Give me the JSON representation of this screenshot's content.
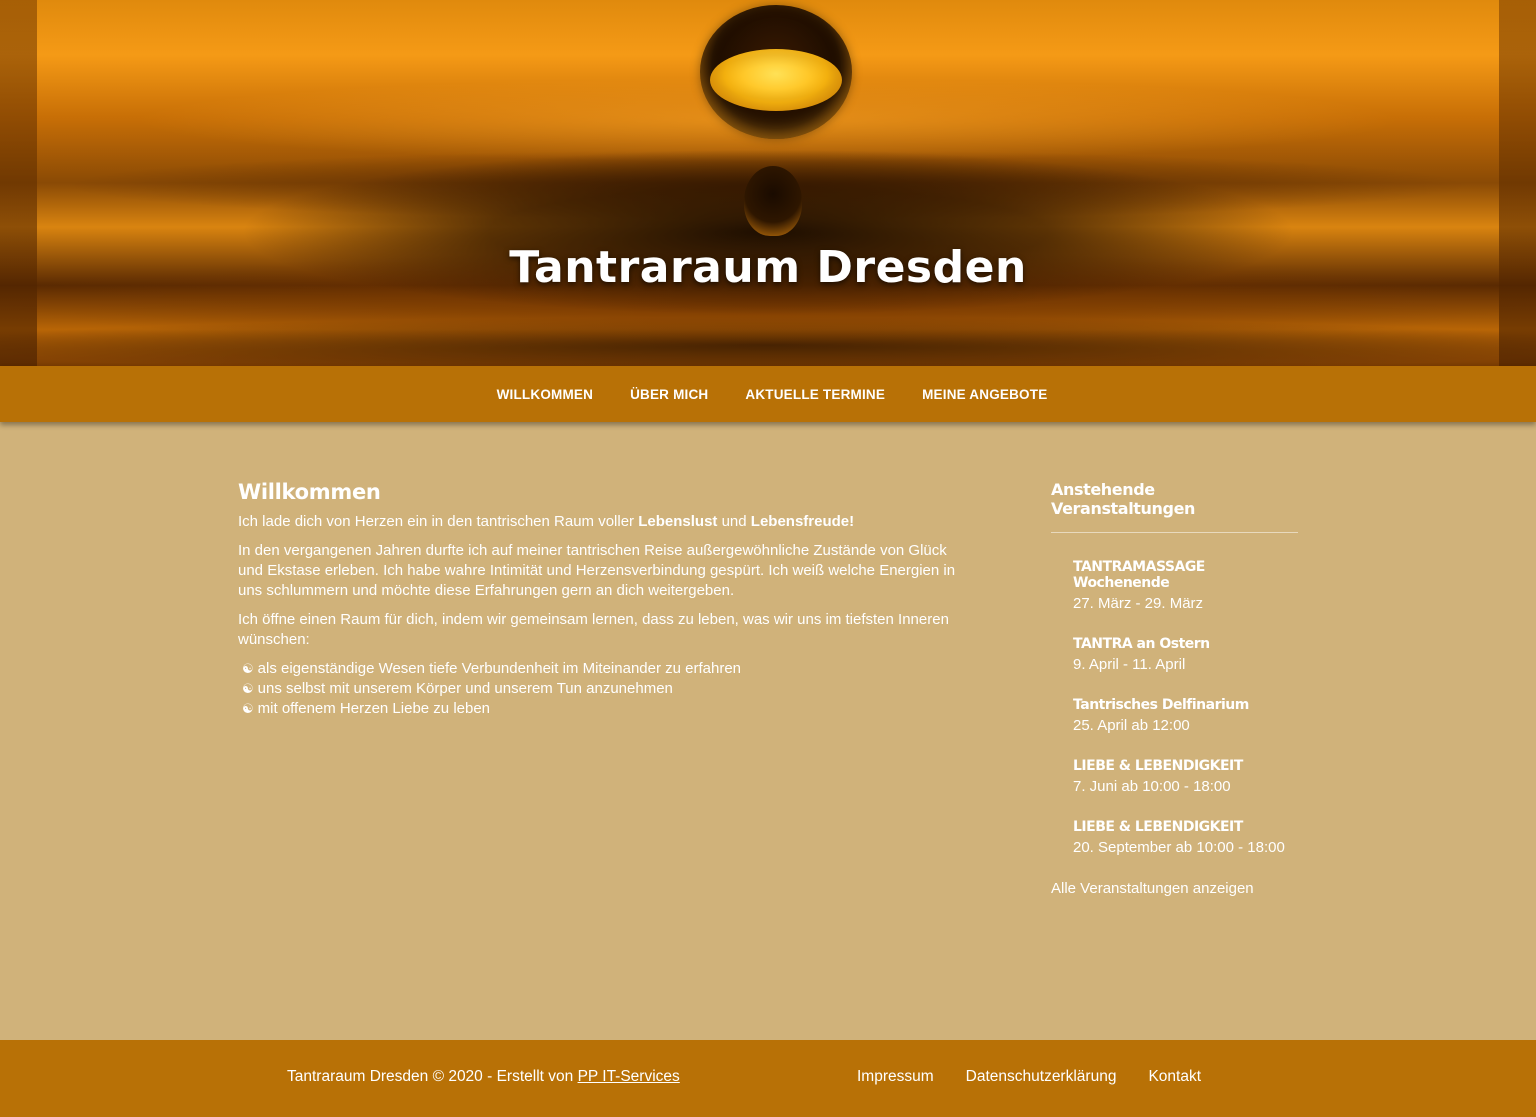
{
  "site": {
    "title": "Tantraraum Dresden"
  },
  "nav": {
    "items": [
      "WILLKOMMEN",
      "ÜBER MICH",
      "AKTUELLE TERMINE",
      "MEINE ANGEBOTE"
    ]
  },
  "main": {
    "heading": "Willkommen",
    "p1_pre": "Ich lade dich von Herzen ein in den tantrischen Raum voller ",
    "p1_b1": "Lebenslust",
    "p1_mid": " und ",
    "p1_b2": "Lebensfreude!",
    "p2": "In den vergangenen Jahren durfte ich auf meiner tantrischen Reise außergewöhnliche Zustände von Glück und Ekstase erleben. Ich habe wahre Intimität und Herzensverbindung gespürt. Ich weiß welche Energien in uns schlummern und möchte diese Erfahrungen gern an dich weitergeben.",
    "p3": "Ich öffne einen Raum für dich, indem wir gemeinsam lernen, dass zu leben, was wir uns im tiefsten Inneren wünschen:",
    "list": [
      "als eigenständige Wesen tiefe Verbundenheit im Miteinander zu erfahren",
      "uns selbst mit unserem Körper und unserem Tun anzunehmen",
      "mit offenem Herzen Liebe zu leben"
    ],
    "list_icon": "yin-yang-icon"
  },
  "sidebar": {
    "heading": "Anstehende Veranstaltungen",
    "events": [
      {
        "title": "TANTRAMASSAGE Wochenende",
        "date": "27. März - 29. März"
      },
      {
        "title": "TANTRA an Ostern",
        "date": "9. April - 11. April"
      },
      {
        "title": "Tantrisches Delfinarium",
        "date": "25. April ab 12:00"
      },
      {
        "title": "LIEBE & LEBENDIGKEIT",
        "date": "7. Juni ab 10:00 - 18:00"
      },
      {
        "title": "LIEBE & LEBENDIGKEIT",
        "date": "20. September ab 10:00 - 18:00"
      }
    ],
    "all_link": "Alle Veranstaltungen anzeigen"
  },
  "footer": {
    "copy_text": "Tantraraum Dresden © 2020 - Erstellt von ",
    "copy_link": "PP IT-Services",
    "links": [
      "Impressum",
      "Datenschutzerklärung",
      "Kontakt"
    ]
  },
  "colors": {
    "page_bg": "#d0b27a",
    "nav_bg": "#b87106",
    "footer_bg": "#b87106",
    "text": "#ffffff"
  }
}
